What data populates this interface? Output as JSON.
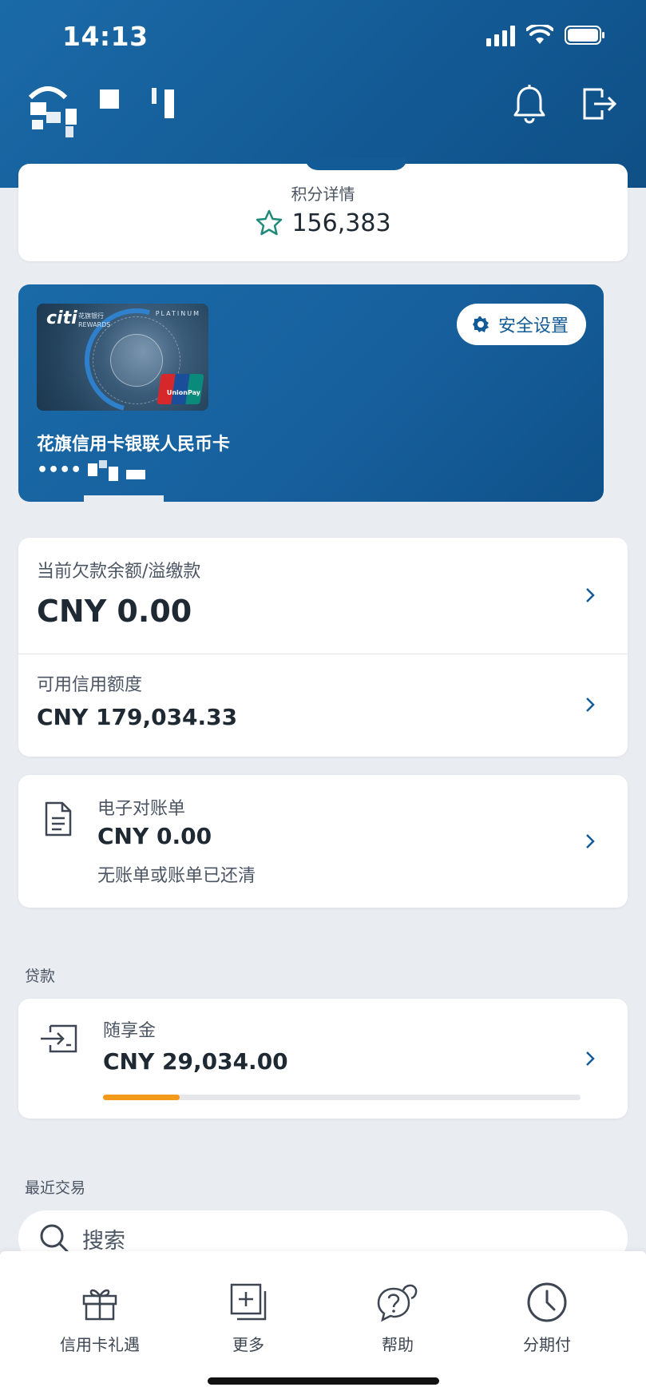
{
  "status_bar": {
    "time": "14:13"
  },
  "points": {
    "label": "积分详情",
    "value": "156,383"
  },
  "card": {
    "brand_text": "citi",
    "name": "花旗信用卡银联人民币卡",
    "number_mask": "••••"
  },
  "security": {
    "label": "安全设置"
  },
  "balance": {
    "label": "当前欠款余额/溢缴款",
    "value": "CNY 0.00"
  },
  "credit": {
    "label": "可用信用额度",
    "value": "CNY 179,034.33"
  },
  "statement": {
    "label": "电子对账单",
    "value": "CNY 0.00",
    "note": "无账单或账单已还清"
  },
  "loans": {
    "section_title": "贷款",
    "item_label": "随享金",
    "item_value": "CNY 29,034.00",
    "progress": 0.16,
    "progress_color": "#f39a1b"
  },
  "recent": {
    "section_title": "最近交易"
  },
  "search": {
    "placeholder": "搜索"
  },
  "nav": [
    {
      "label": "信用卡礼遇",
      "icon": "gift-icon"
    },
    {
      "label": "更多",
      "icon": "add-square-icon"
    },
    {
      "label": "帮助",
      "icon": "help-chat-icon"
    },
    {
      "label": "分期付",
      "icon": "clock-icon"
    }
  ],
  "colors": {
    "brand_blue": "#135b96",
    "accent_orange": "#f39a1b",
    "star_green": "#1f8a7a"
  }
}
